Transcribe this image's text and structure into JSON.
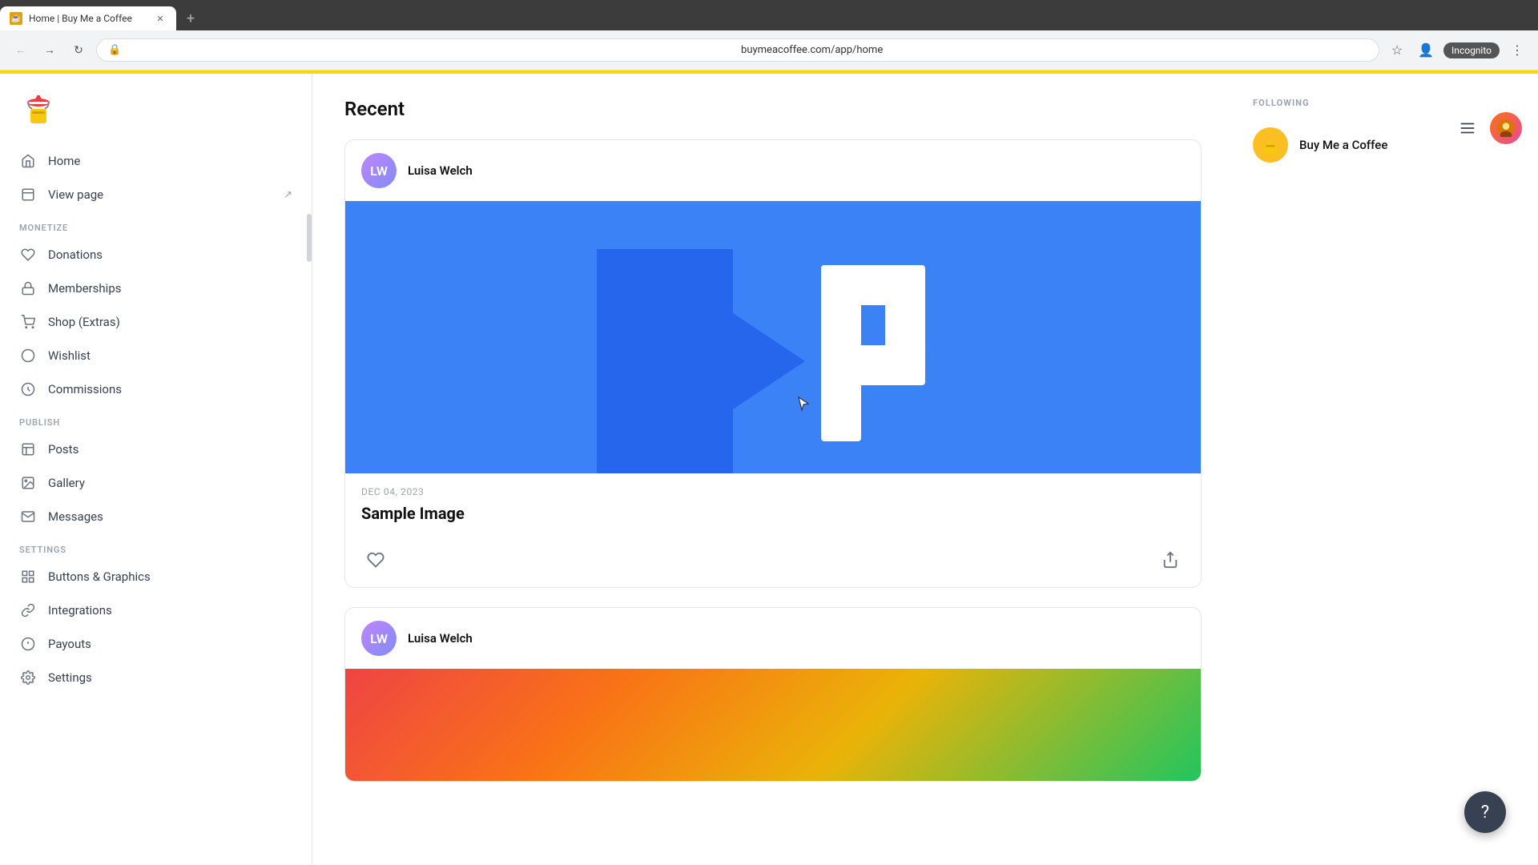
{
  "browser": {
    "tab_title": "Home | Buy Me a Coffee",
    "tab_favicon": "☕",
    "url": "buymeacoffee.com/app/home",
    "incognito_label": "Incognito"
  },
  "sidebar": {
    "nav_items": [
      {
        "id": "home",
        "label": "Home",
        "icon": "🏠"
      },
      {
        "id": "view-page",
        "label": "View page",
        "icon": "📄",
        "external": true
      }
    ],
    "sections": [
      {
        "title": "MONETIZE",
        "items": [
          {
            "id": "donations",
            "label": "Donations",
            "icon": "❤️"
          },
          {
            "id": "memberships",
            "label": "Memberships",
            "icon": "🔒"
          },
          {
            "id": "shop",
            "label": "Shop (Extras)",
            "icon": "🛍️"
          },
          {
            "id": "wishlist",
            "label": "Wishlist",
            "icon": "⭕"
          },
          {
            "id": "commissions",
            "label": "Commissions",
            "icon": "⭕"
          }
        ]
      },
      {
        "title": "PUBLISH",
        "items": [
          {
            "id": "posts",
            "label": "Posts",
            "icon": "📋"
          },
          {
            "id": "gallery",
            "label": "Gallery",
            "icon": "🖼️"
          },
          {
            "id": "messages",
            "label": "Messages",
            "icon": "✉️"
          }
        ]
      },
      {
        "title": "SETTINGS",
        "items": [
          {
            "id": "buttons-graphics",
            "label": "Buttons & Graphics",
            "icon": "⊞"
          },
          {
            "id": "integrations",
            "label": "Integrations",
            "icon": "🔗"
          },
          {
            "id": "payouts",
            "label": "Payouts",
            "icon": "💲"
          },
          {
            "id": "settings",
            "label": "Settings",
            "icon": "⚙️"
          }
        ]
      }
    ]
  },
  "main": {
    "section_title": "Recent",
    "post1": {
      "author": "Luisa Welch",
      "date": "DEC 04, 2023",
      "title": "Sample Image"
    },
    "post2": {
      "author": "Luisa Welch"
    }
  },
  "right_sidebar": {
    "following_title": "FOLLOWING",
    "following_items": [
      {
        "name": "Buy Me a Coffee"
      }
    ]
  },
  "help_button_label": "?"
}
